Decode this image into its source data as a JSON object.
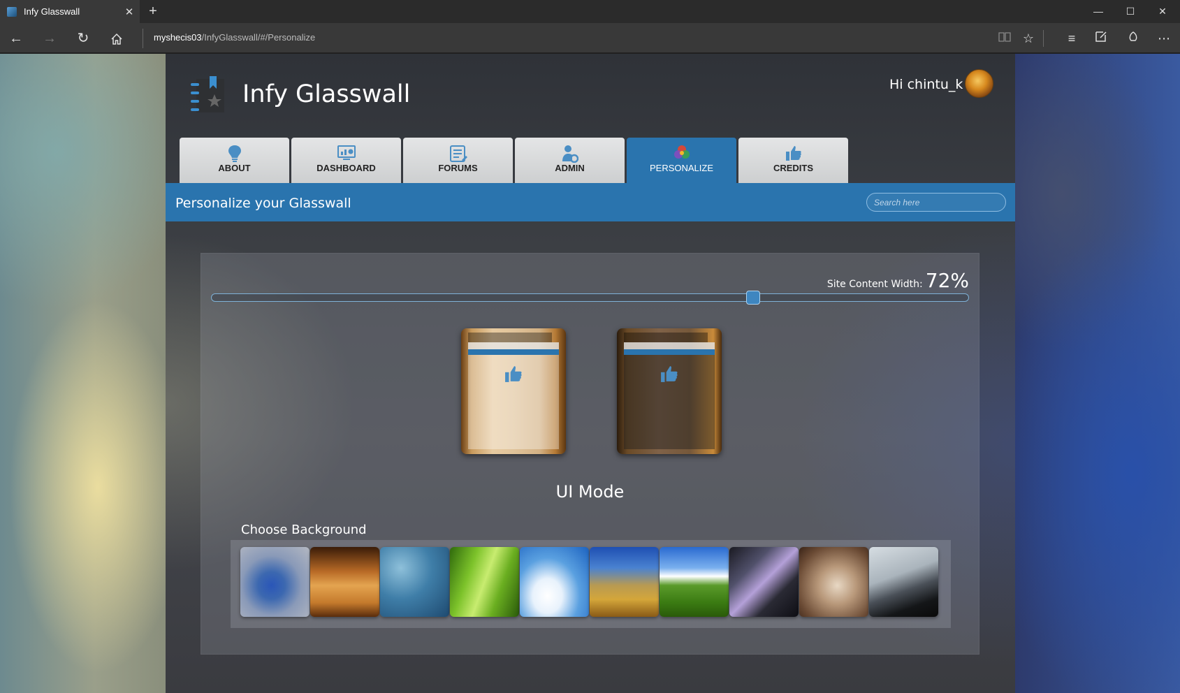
{
  "browser": {
    "tab_title": "Infy Glasswall",
    "url_host": "myshecis03",
    "url_path": "/InfyGlasswall/#/Personalize"
  },
  "site": {
    "brand": "Infy Glasswall",
    "greeting": "Hi chintu_k"
  },
  "nav": {
    "tabs": [
      {
        "label": "ABOUT",
        "icon": "lightbulb-icon"
      },
      {
        "label": "DASHBOARD",
        "icon": "monitor-chart-icon"
      },
      {
        "label": "FORUMS",
        "icon": "forum-list-icon"
      },
      {
        "label": "ADMIN",
        "icon": "user-gear-icon"
      },
      {
        "label": "PERSONALIZE",
        "icon": "color-wheel-icon",
        "active": true
      },
      {
        "label": "CREDITS",
        "icon": "thumbs-up-icon"
      }
    ]
  },
  "banner": {
    "title": "Personalize your Glasswall",
    "search_placeholder": "Search here"
  },
  "personalize": {
    "width_label": "Site Content Width:",
    "width_value": "72%",
    "width_fraction": 0.72,
    "ui_mode_label": "UI Mode",
    "ui_modes": [
      "light",
      "dark"
    ],
    "background_label": "Choose Background",
    "backgrounds": [
      "blur-blue",
      "wheat-field",
      "water-drops",
      "green-grass",
      "blue-sky-clouds",
      "golden-field-blur",
      "green-meadow",
      "skyscrapers",
      "sleeping-puppy",
      "black-sand-beach"
    ]
  },
  "colors": {
    "accent": "#2a74ae",
    "tab_bg": "#d6d8d9",
    "chrome_bg": "#393939"
  }
}
